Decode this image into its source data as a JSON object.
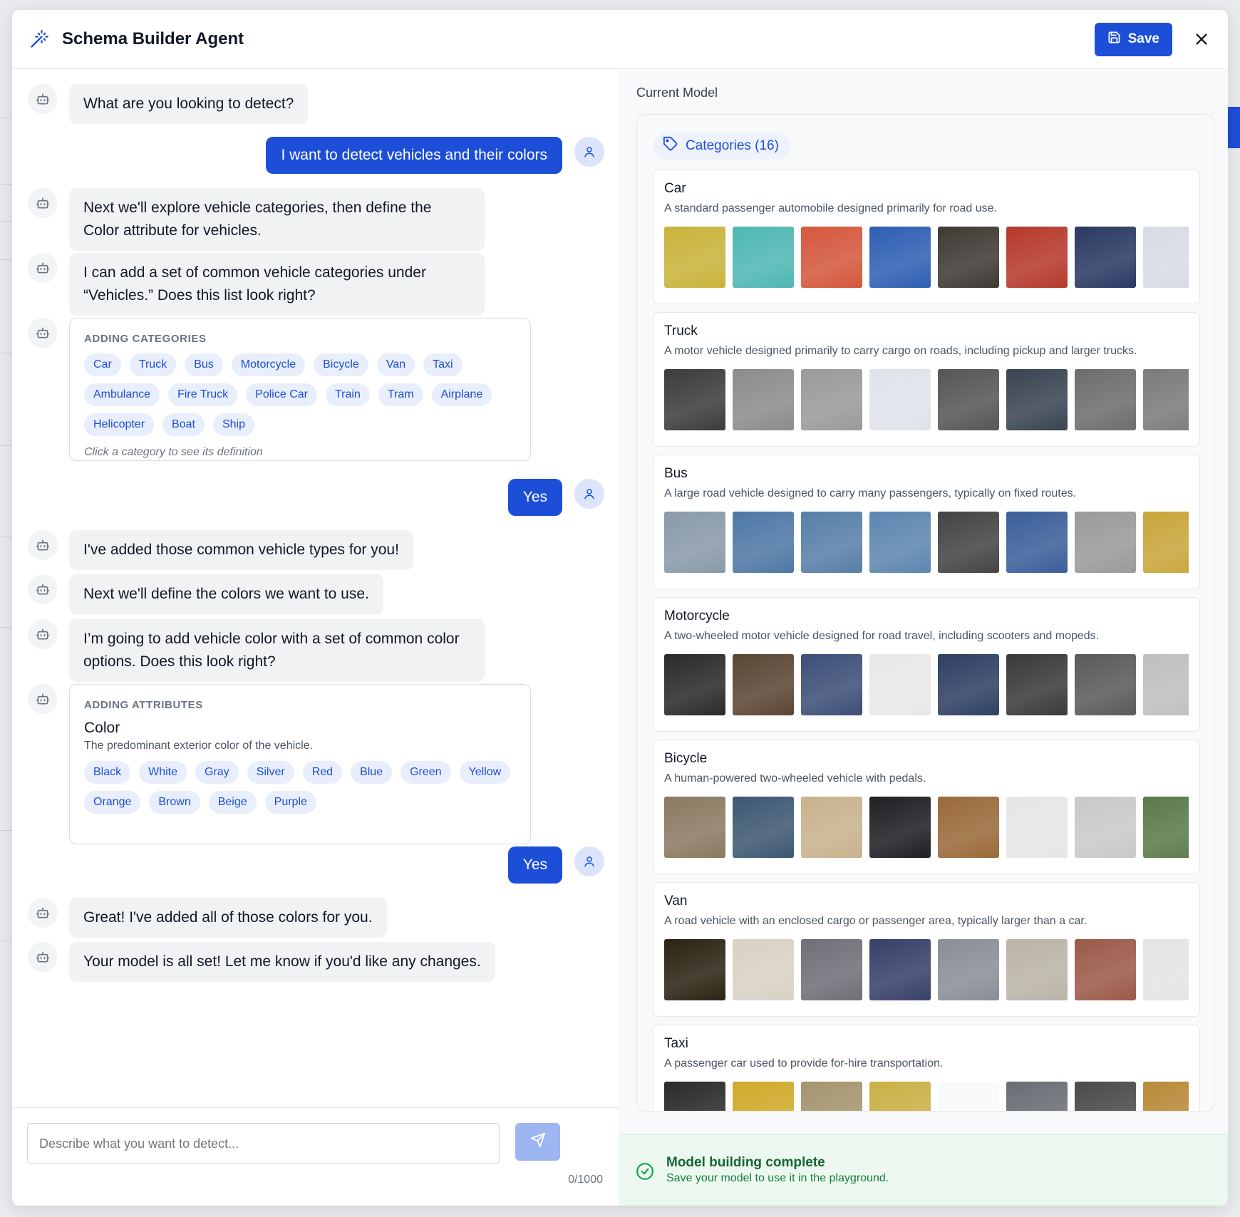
{
  "header": {
    "title": "Schema Builder Agent",
    "save_label": "Save"
  },
  "chat": {
    "messages": [
      {
        "role": "bot",
        "text": "What are you looking to detect?"
      },
      {
        "role": "user",
        "text": "I want to detect vehicles and their colors"
      },
      {
        "role": "bot",
        "text": "Next we'll explore vehicle categories, then define the Color attribute for vehicles."
      },
      {
        "role": "bot",
        "text": "I can add a set of common vehicle categories under “Vehicles.” Does this list look right?"
      },
      {
        "role": "user",
        "text": "Yes"
      },
      {
        "role": "bot",
        "text": "I've added those common vehicle types for you!"
      },
      {
        "role": "bot",
        "text": "Next we'll define the colors we want to use."
      },
      {
        "role": "bot",
        "text": "I’m going to add vehicle color with a set of common color options. Does this look right?"
      },
      {
        "role": "user",
        "text": "Yes"
      },
      {
        "role": "bot",
        "text": "Great! I've added all of those colors for you."
      },
      {
        "role": "bot",
        "text": "Your model is all set! Let me know if you'd like any changes."
      }
    ],
    "categories_card": {
      "label": "ADDING CATEGORIES",
      "chips": [
        "Car",
        "Truck",
        "Bus",
        "Motorcycle",
        "Bicycle",
        "Van",
        "Taxi",
        "Ambulance",
        "Fire Truck",
        "Police Car",
        "Train",
        "Tram",
        "Airplane",
        "Helicopter",
        "Boat",
        "Ship"
      ],
      "hint": "Click a category to see its definition"
    },
    "attributes_card": {
      "label": "ADDING ATTRIBUTES",
      "name": "Color",
      "description": "The predominant exterior color of the vehicle.",
      "chips": [
        "Black",
        "White",
        "Gray",
        "Silver",
        "Red",
        "Blue",
        "Green",
        "Yellow",
        "Orange",
        "Brown",
        "Beige",
        "Purple"
      ]
    },
    "composer": {
      "placeholder": "Describe what you want to detect...",
      "counter": "0/1000"
    }
  },
  "model": {
    "title": "Current Model",
    "tab_label": "Categories (16)",
    "categories": [
      {
        "name": "Car",
        "description": "A standard passenger automobile designed primarily for road use."
      },
      {
        "name": "Truck",
        "description": "A motor vehicle designed primarily to carry cargo on roads, including pickup and larger trucks."
      },
      {
        "name": "Bus",
        "description": "A large road vehicle designed to carry many passengers, typically on fixed routes."
      },
      {
        "name": "Motorcycle",
        "description": "A two-wheeled motor vehicle designed for road travel, including scooters and mopeds."
      },
      {
        "name": "Bicycle",
        "description": "A human-powered two-wheeled vehicle with pedals."
      },
      {
        "name": "Van",
        "description": "A road vehicle with an enclosed cargo or passenger area, typically larger than a car."
      },
      {
        "name": "Taxi",
        "description": "A passenger car used to provide for-hire transportation."
      }
    ]
  },
  "status": {
    "title": "Model building complete",
    "subtitle": "Save your model to use it in the playground."
  },
  "colors": {
    "primary": "#1d4ed8",
    "chip_bg": "#e8eefb",
    "success": "#16a34a"
  }
}
